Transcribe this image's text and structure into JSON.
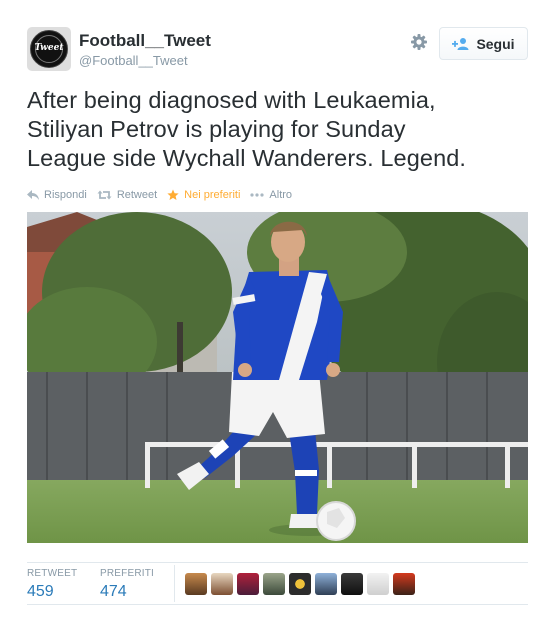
{
  "header": {
    "full_name": "Football__Tweet",
    "screen_name": "@Football__Tweet",
    "avatar_text": "Tweet",
    "follow_label": "Segui"
  },
  "tweet": {
    "lines": [
      "After being diagnosed with Leukaemia,",
      "Stiliyan Petrov is playing for Sunday",
      "League side Wychall Wanderers. Legend."
    ]
  },
  "actions": [
    {
      "name": "reply",
      "label": "Rispondi"
    },
    {
      "name": "retweet",
      "label": "Retweet"
    },
    {
      "name": "favorite",
      "label": "Nei preferiti"
    },
    {
      "name": "more",
      "label": "Altro"
    }
  ],
  "stats": {
    "retweet_label": "RETWEET",
    "retweet_count": "459",
    "favorites_label": "PREFERITI",
    "favorites_count": "474"
  },
  "colors": {
    "link_blue": "#2b7bb9",
    "gray_text": "#8899a6",
    "favorite_gold": "#ffac33",
    "border": "#e1e8ed"
  }
}
